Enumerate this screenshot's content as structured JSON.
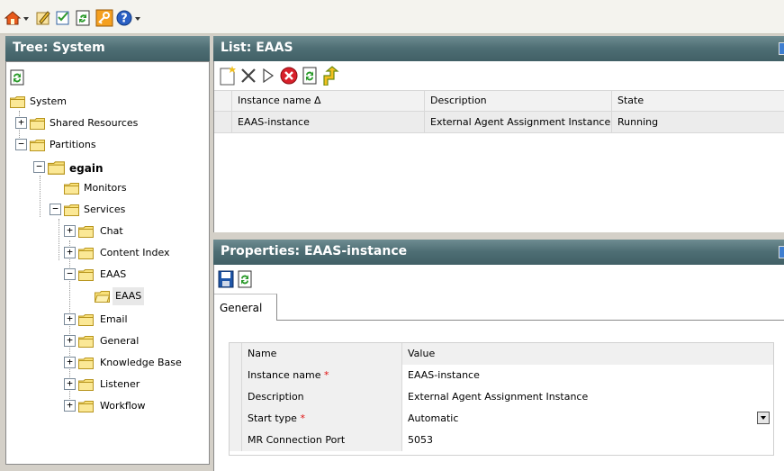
{
  "tree": {
    "title": "Tree: System",
    "items": [
      {
        "label": "System",
        "bold": false
      },
      {
        "label": "Shared Resources",
        "bold": false
      },
      {
        "label": "Partitions",
        "bold": false
      },
      {
        "label": "egain",
        "bold": true
      },
      {
        "label": "Monitors",
        "bold": false
      },
      {
        "label": "Services",
        "bold": false
      },
      {
        "label": "Chat",
        "bold": false
      },
      {
        "label": "Content Index",
        "bold": false
      },
      {
        "label": "EAAS",
        "bold": false
      },
      {
        "label": "EAAS",
        "bold": false
      },
      {
        "label": "Email",
        "bold": false
      },
      {
        "label": "General",
        "bold": false
      },
      {
        "label": "Knowledge Base",
        "bold": false
      },
      {
        "label": "Listener",
        "bold": false
      },
      {
        "label": "Workflow",
        "bold": false
      }
    ]
  },
  "list": {
    "title": "List: EAAS",
    "columns": [
      "Instance name Δ",
      "Description",
      "State"
    ],
    "rows": [
      [
        "EAAS-instance",
        "External Agent Assignment Instance",
        "Running"
      ]
    ]
  },
  "properties": {
    "title": "Properties: EAAS-instance",
    "tab": "General",
    "header": {
      "name": "Name",
      "value": "Value"
    },
    "rows": [
      {
        "name": "Instance name",
        "required": "*",
        "value": "EAAS-instance"
      },
      {
        "name": "Description",
        "required": "",
        "value": "External Agent Assignment Instance"
      },
      {
        "name": "Start type",
        "required": "*",
        "value": "Automatic"
      },
      {
        "name": "MR Connection Port",
        "required": "",
        "value": "5053"
      }
    ]
  },
  "icons": {
    "home": "home-icon",
    "edit": "edit-icon",
    "checklist": "checklist-icon",
    "refresh": "refresh-icon",
    "key": "key-icon",
    "help": "help-icon",
    "new": "new-icon",
    "delete": "delete-icon",
    "start": "start-icon",
    "stop": "stop-icon",
    "export": "export-icon",
    "save": "save-icon"
  },
  "colors": {
    "header_bar": "#4e6e74",
    "selected_row": "#ececec",
    "required": "#e01010"
  }
}
